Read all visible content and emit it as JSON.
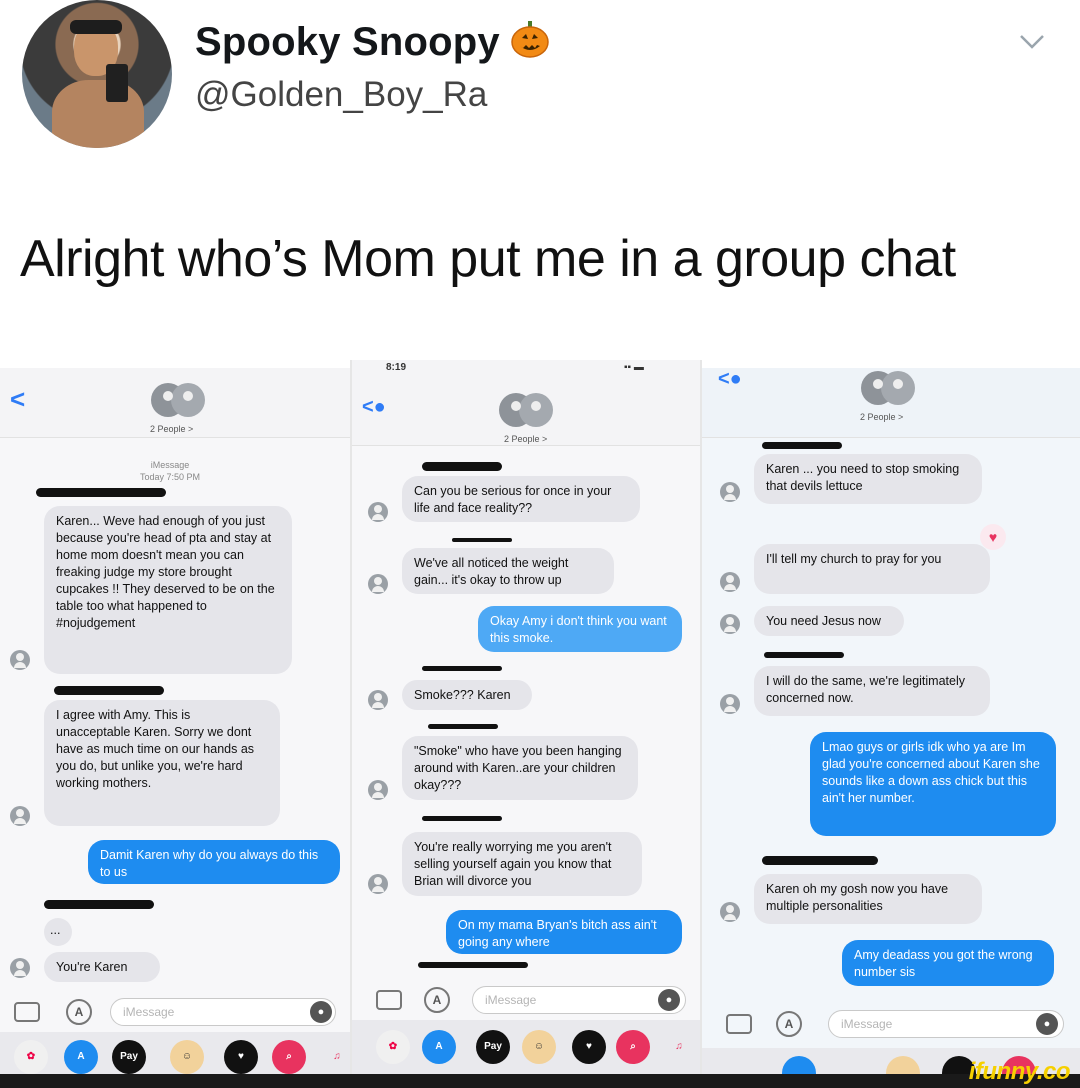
{
  "tweet": {
    "display_name": "Spooky Snoopy",
    "handle": "@Golden_Boy_Ra",
    "text": "Alright who’s Mom put me in a group chat"
  },
  "panels": [
    {
      "people": "2 People >",
      "meta_service": "iMessage",
      "meta_time": "Today 7:50 PM",
      "messages": [
        {
          "from": "them",
          "text": "Karen... Weve had enough of you just because you're head of pta and stay at home mom doesn't mean you can freaking judge my store brought cupcakes !! They deserved to be on the table too what happened to #nojudgement"
        },
        {
          "from": "them",
          "text": "I agree with Amy. This is unacceptable Karen. Sorry we dont have as much time on our hands as you do, but unlike you, we're hard working mothers."
        },
        {
          "from": "me",
          "text": "Damit Karen why do you always do this to us"
        },
        {
          "from": "them",
          "text": "..."
        },
        {
          "from": "them",
          "text": "You're Karen"
        }
      ],
      "input_placeholder": "iMessage"
    },
    {
      "status_time": "8:19",
      "people": "2 People >",
      "messages": [
        {
          "from": "them",
          "text": "Can you be serious for once in your life and face reality??"
        },
        {
          "from": "them",
          "text": "We've all noticed the weight gain... it's okay to throw up"
        },
        {
          "from": "me",
          "text": "Okay Amy i don't think you want this smoke."
        },
        {
          "from": "them",
          "text": "Smoke??? Karen"
        },
        {
          "from": "them",
          "text": "\"Smoke\" who have you been hanging around with Karen..are your children okay???"
        },
        {
          "from": "them",
          "text": "You're really worrying me you aren't selling yourself again you know that Brian will divorce you"
        },
        {
          "from": "me",
          "text": "On my mama Bryan's bitch ass ain't going any where"
        }
      ],
      "input_placeholder": "iMessage"
    },
    {
      "people": "2 People >",
      "messages": [
        {
          "from": "them",
          "text": "Karen ... you need to stop smoking that devils lettuce"
        },
        {
          "from": "them",
          "text": "I'll tell my church to pray for you"
        },
        {
          "from": "them",
          "text": "You need Jesus now"
        },
        {
          "from": "them",
          "text": "I will do the same, we're legitimately concerned now."
        },
        {
          "from": "me",
          "text": "Lmao guys or girls idk who ya are Im glad you're concerned about Karen she sounds like a down ass chick but this ain't her number."
        },
        {
          "from": "them",
          "text": "Karen oh my gosh now you have multiple personalities"
        },
        {
          "from": "me",
          "text": "Amy deadass you got the wrong number sis"
        }
      ],
      "input_placeholder": "iMessage"
    }
  ],
  "apps": {
    "applepay": "Pay"
  },
  "watermark": "ifunny.co"
}
